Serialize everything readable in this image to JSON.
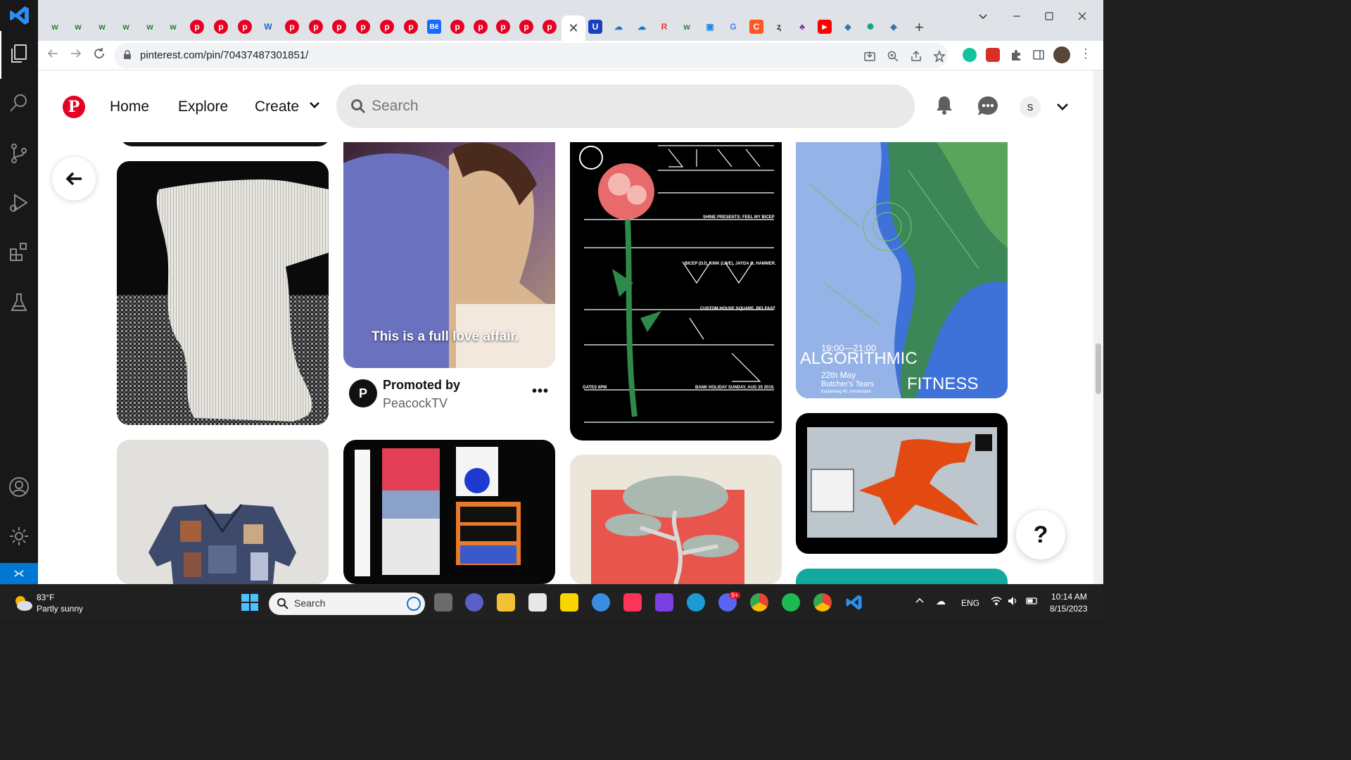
{
  "browser": {
    "url": "pinterest.com/pin/70437487301851/",
    "active_tab_close": "✕",
    "new_tab": "+"
  },
  "pinterest": {
    "logo": "P",
    "nav": {
      "home": "Home",
      "explore": "Explore",
      "create": "Create"
    },
    "search_placeholder": "Search",
    "avatar_initial": "S",
    "help": "?",
    "promo": {
      "line1": "Promoted by",
      "line2": "PeacockTV",
      "avatar_initial": "P",
      "more": "•••"
    },
    "video_caption": "This is a full love affair.",
    "poster_feel_my_bicep": {
      "line1": "SHINE PRESENTS: FEEL MY BICEP",
      "line2": "BICEP (DJ), KINK (LIVE), JAYDA G, HAMMER.",
      "line3": "CUSTOM HOUSE SQUARE, BELFAST",
      "line4": "GATES 6PM",
      "line5": "BANK HOLIDAY SUNDAY, AUG 25 2019."
    },
    "poster_algorithmic": {
      "time": "19:00—21:00",
      "date": "22th May",
      "venue": "Butcher's Tears",
      "city": "Karperweg 45, Amsterdam",
      "title_a": "ALGORITHMIC",
      "title_b": "FITNESS"
    }
  },
  "taskbar": {
    "weather_temp": "83°F",
    "weather_desc": "Partly sunny",
    "search": "Search",
    "lang": "ENG",
    "time": "10:14 AM",
    "date": "8/15/2023",
    "discord_badge": "9+"
  },
  "colors": {
    "pinterest_red": "#e60023",
    "vscode_blue": "#0078d4",
    "taskbar_bg": "#202020"
  }
}
